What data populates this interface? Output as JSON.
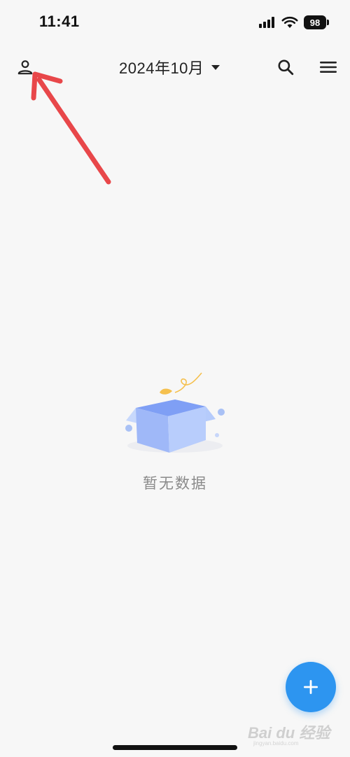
{
  "status_bar": {
    "time": "11:41",
    "battery": "98",
    "icons": [
      "signal-icon",
      "wifi-icon",
      "battery-icon"
    ]
  },
  "header": {
    "profile_icon": "person-icon",
    "month": "2024年10月",
    "dropdown_icon": "caret-down-icon",
    "search_icon": "search-icon",
    "menu_icon": "hamburger-menu-icon"
  },
  "empty_state": {
    "illustration": "empty-box-icon",
    "message": "暂无数据"
  },
  "fab": {
    "icon": "plus-icon",
    "color": "#2d95f0"
  },
  "watermark": {
    "text": "Bai du 经验",
    "sub": "jingyan.baidu.com"
  },
  "annotation": {
    "color": "#e8474a"
  }
}
